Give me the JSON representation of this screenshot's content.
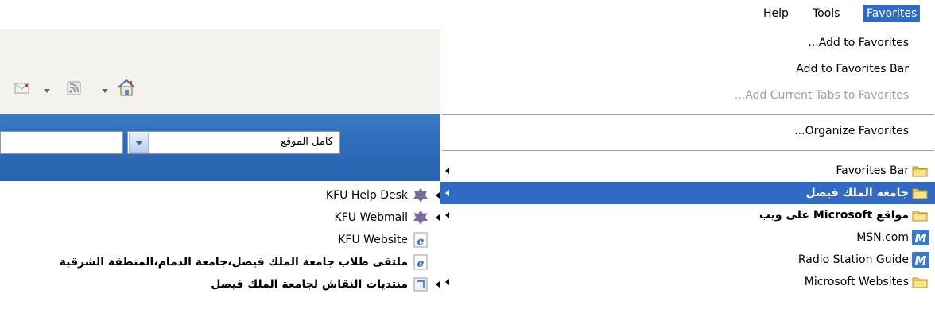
{
  "menubar": {
    "items": [
      "Help",
      "Tools",
      "Favorites"
    ]
  },
  "search": {
    "scope": "كامل الموقع"
  },
  "page_links": [
    {
      "label": "KFU Help Desk",
      "icon": "puzzle-icon",
      "bold": false,
      "submenu": true
    },
    {
      "label": "KFU Webmail",
      "icon": "puzzle-icon",
      "bold": false,
      "submenu": true
    },
    {
      "label": "KFU Website",
      "icon": "ie-page-icon",
      "bold": false,
      "submenu": false
    },
    {
      "label": "ملتقى طلاب جامعة الملك فيصل،جامعة الدمام،المنطقة الشرقية",
      "icon": "ie-page-icon",
      "bold": true,
      "submenu": false
    },
    {
      "label": "منتديات النقاش لجامعة الملك فيصل",
      "icon": "folder-page-icon",
      "bold": true,
      "submenu": true
    }
  ],
  "favorites_menu": {
    "add_to_favorites": "...Add to Favorites",
    "add_to_favorites_bar": "Add to Favorites Bar",
    "add_current_tabs": "...Add Current Tabs to Favorites",
    "organize_favorites": "...Organize Favorites",
    "entries": [
      {
        "label": "Favorites Bar",
        "icon": "folder-icon",
        "submenu": true,
        "selected": false,
        "bold": false
      },
      {
        "label": "جامعة الملك فيصل",
        "icon": "folder-icon",
        "submenu": true,
        "selected": true,
        "bold": true
      },
      {
        "label": "مواقع Microsoft على ويب",
        "icon": "folder-icon",
        "submenu": true,
        "selected": false,
        "bold": true
      },
      {
        "label": "MSN.com",
        "icon": "msn-icon",
        "submenu": false,
        "selected": false,
        "bold": false
      },
      {
        "label": "Radio Station Guide",
        "icon": "msn-icon",
        "submenu": false,
        "selected": false,
        "bold": false
      },
      {
        "label": "Microsoft Websites",
        "icon": "folder-icon",
        "submenu": true,
        "selected": false,
        "bold": false
      }
    ]
  },
  "colors": {
    "selection": "#316ac5",
    "search_band": "#2f6cb9",
    "disabled_text": "#a0a0a0"
  }
}
